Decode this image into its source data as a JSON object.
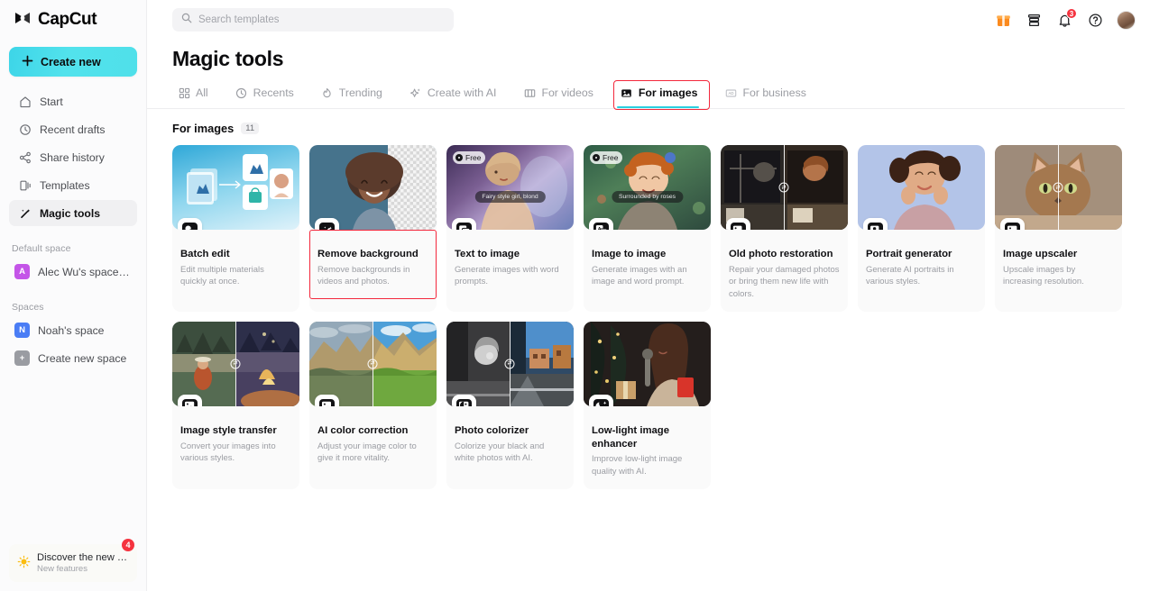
{
  "brand": {
    "name": "CapCut",
    "accent": "#29d0e0",
    "highlight": "#f3283c"
  },
  "sidebar": {
    "create_new": "Create new",
    "nav": [
      {
        "label": "Start",
        "icon": "home-icon"
      },
      {
        "label": "Recent drafts",
        "icon": "clock-icon"
      },
      {
        "label": "Share history",
        "icon": "share-icon"
      },
      {
        "label": "Templates",
        "icon": "templates-icon"
      },
      {
        "label": "Magic tools",
        "icon": "magic-wand-icon"
      }
    ],
    "default_space_label": "Default space",
    "default_space": {
      "initial": "A",
      "name": "Alec Wu's space –...",
      "color": "#c455e8"
    },
    "spaces_label": "Spaces",
    "spaces": [
      {
        "initial": "N",
        "name": "Noah's space",
        "color": "#4a7df5"
      },
      {
        "initial": "+",
        "name": "Create new space",
        "color": "#9a9ca2"
      }
    ],
    "promo": {
      "title": "Discover the new M...",
      "subtitle": "New features",
      "badge": "4",
      "icon": "sun-icon"
    }
  },
  "topbar": {
    "search_placeholder": "Search templates",
    "search_value": "",
    "icons": [
      {
        "name": "gift-icon"
      },
      {
        "name": "archive-icon"
      },
      {
        "name": "bell-icon",
        "badge": "3"
      },
      {
        "name": "help-circle-icon"
      }
    ]
  },
  "page": {
    "title": "Magic tools"
  },
  "tabs": [
    {
      "label": "All",
      "icon": "grid-icon",
      "active": false
    },
    {
      "label": "Recents",
      "icon": "clock-icon",
      "active": false
    },
    {
      "label": "Trending",
      "icon": "flame-icon",
      "active": false
    },
    {
      "label": "Create with AI",
      "icon": "sparkle-icon",
      "active": false
    },
    {
      "label": "For videos",
      "icon": "video-icon",
      "active": false
    },
    {
      "label": "For images",
      "icon": "image-icon",
      "active": true,
      "highlighted": true
    },
    {
      "label": "For business",
      "icon": "business-icon",
      "active": false
    }
  ],
  "section": {
    "title": "For images",
    "count": "11"
  },
  "cards": [
    {
      "title": "Batch edit",
      "desc": "Edit multiple materials quickly at once.",
      "badge": null,
      "prompt": null,
      "icon": "batch-edit-icon",
      "highlighted": false,
      "thumb_style": "batch"
    },
    {
      "title": "Remove background",
      "desc": "Remove backgrounds in videos and photos.",
      "badge": null,
      "prompt": null,
      "icon": "magic-wand-icon",
      "highlighted": true,
      "thumb_style": "portrait-cutout"
    },
    {
      "title": "Text to image",
      "desc": "Generate images with word prompts.",
      "badge": "Free",
      "prompt": "Fairy style girl, blond",
      "icon": "text-to-image-icon",
      "highlighted": false,
      "thumb_style": "fairy"
    },
    {
      "title": "Image to image",
      "desc": "Generate images with an image and word prompt.",
      "badge": "Free",
      "prompt": "Surrounded by roses",
      "icon": "image-to-image-icon",
      "highlighted": false,
      "thumb_style": "roses"
    },
    {
      "title": "Old photo restoration",
      "desc": "Repair your damaged photos or bring them new life with colors.",
      "badge": null,
      "prompt": null,
      "icon": "restore-photo-icon",
      "highlighted": false,
      "thumb_style": "oldphoto"
    },
    {
      "title": "Portrait generator",
      "desc": "Generate AI portraits in various styles.",
      "badge": null,
      "prompt": null,
      "icon": "portrait-icon",
      "highlighted": false,
      "thumb_style": "portrait-blue"
    },
    {
      "title": "Image upscaler",
      "desc": "Upscale images by increasing resolution.",
      "badge": null,
      "prompt": null,
      "icon": "upscale-4k-icon",
      "highlighted": false,
      "thumb_style": "cat"
    },
    {
      "title": "Image style transfer",
      "desc": "Convert your images into various styles.",
      "badge": null,
      "prompt": null,
      "icon": "style-transfer-icon",
      "highlighted": false,
      "thumb_style": "camp"
    },
    {
      "title": "AI color correction",
      "desc": "Adjust your image color to give it more vitality.",
      "badge": null,
      "prompt": null,
      "icon": "color-correct-icon",
      "highlighted": false,
      "thumb_style": "mountain"
    },
    {
      "title": "Photo colorizer",
      "desc": "Colorize your black and white photos with AI.",
      "badge": null,
      "prompt": null,
      "icon": "colorize-icon",
      "highlighted": false,
      "thumb_style": "street"
    },
    {
      "title": "Low-light image enhancer",
      "desc": "Improve low-light image quality with AI.",
      "badge": null,
      "prompt": null,
      "icon": "moon-icon",
      "highlighted": false,
      "thumb_style": "lowlight"
    }
  ]
}
